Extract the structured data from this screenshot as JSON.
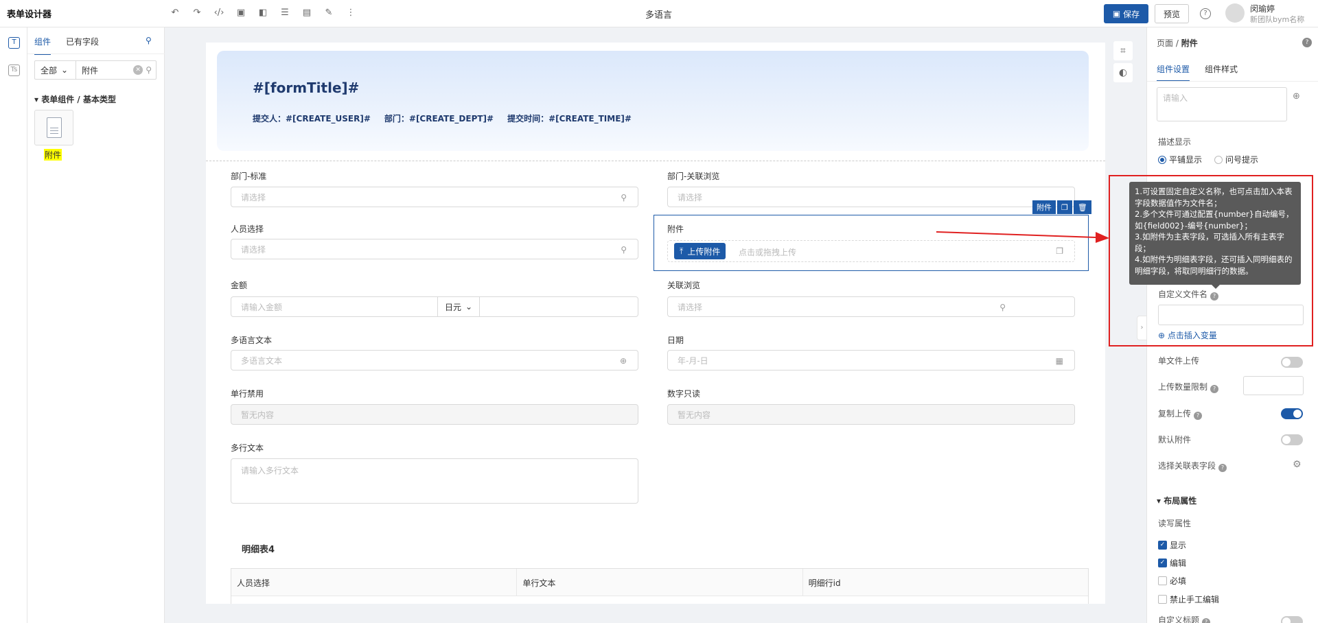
{
  "app": {
    "title": "表单设计器",
    "center_title": "多语言",
    "save_label": "保存",
    "preview_label": "预览",
    "help_glyph": "?",
    "user_name": "闵瑜婷",
    "user_sub": "新团队bym名称"
  },
  "toolbar_icons": [
    "undo-icon",
    "redo-icon",
    "code-icon",
    "image-icon",
    "layout-icon",
    "storage-icon",
    "chart-icon",
    "edit-doc-icon",
    "more-icon"
  ],
  "rail": {
    "icon1": "T",
    "icon2": "Ts"
  },
  "left_panel": {
    "tabs": [
      "组件",
      "已有字段"
    ],
    "filter_value": "全部",
    "search_value": "附件",
    "group_title": "表单组件 / 基本类型",
    "component_label": "附件"
  },
  "canvas": {
    "form_title": "#[formTitle]#",
    "meta": {
      "submitter": "提交人：#[CREATE_USER]#",
      "dept": "部门：#[CREATE_DEPT]#",
      "time": "提交时间：#[CREATE_TIME]#"
    },
    "fields": {
      "dept_std": {
        "label": "部门-标准",
        "placeholder": "请选择"
      },
      "dept_link": {
        "label": "部门-关联浏览",
        "placeholder": "请选择"
      },
      "person": {
        "label": "人员选择",
        "placeholder": "请选择"
      },
      "attachment": {
        "label": "附件",
        "upload": "上传附件",
        "hint": "点击或拖拽上传"
      },
      "amount": {
        "label": "金额",
        "placeholder": "请输入金额",
        "currency": "日元"
      },
      "link_browse": {
        "label": "关联浏览",
        "placeholder": "请选择"
      },
      "ml_text": {
        "label": "多语言文本",
        "placeholder": "多语言文本"
      },
      "date": {
        "label": "日期",
        "placeholder": "年-月-日"
      },
      "single_disabled": {
        "label": "单行禁用",
        "placeholder": "暂无内容"
      },
      "number_readonly": {
        "label": "数字只读",
        "placeholder": "暂无内容"
      },
      "multiline": {
        "label": "多行文本",
        "placeholder": "请输入多行文本"
      }
    },
    "selected_toolbar": {
      "label": "附件"
    },
    "detail": {
      "title": "明细表4",
      "columns": [
        "人员选择",
        "单行文本",
        "明细行id"
      ]
    }
  },
  "right_panel": {
    "breadcrumb_parent": "页面 /",
    "breadcrumb_current": "附件",
    "tabs": [
      "组件设置",
      "组件样式"
    ],
    "textarea_placeholder": "请输入",
    "desc_display_label": "描述显示",
    "radio_options": [
      "平铺显示",
      "问号提示"
    ],
    "custom_filename_label": "自定义文件名",
    "insert_var": "点击插入变量",
    "single_upload": "单文件上传",
    "upload_limit": "上传数量限制",
    "copy_upload": "复制上传",
    "default_attachment": "默认附件",
    "select_related": "选择关联表字段",
    "layout_section": "布局属性",
    "rw_label": "读写属性",
    "checks": [
      {
        "label": "显示",
        "checked": true
      },
      {
        "label": "编辑",
        "checked": true
      },
      {
        "label": "必填",
        "checked": false
      },
      {
        "label": "禁止手工编辑",
        "checked": false
      }
    ],
    "custom_title": "自定义标题",
    "toggles": {
      "single_upload": false,
      "copy_upload": true,
      "default_attachment": false
    }
  },
  "tooltip": {
    "lines": [
      "1.可设置固定自定义名称，也可点击加入本表字段数据值作为文件名；",
      "2.多个文件可通过配置{number}自动编号，如{field002}-编号{number}；",
      "3.如附件为主表字段，可选插入所有主表字段；",
      "4.如附件为明细表字段，还可插入同明细表的明细字段，将取同明细行的数据。"
    ]
  },
  "colors": {
    "accent": "#1d5aa8",
    "annotation": "#e02020"
  }
}
